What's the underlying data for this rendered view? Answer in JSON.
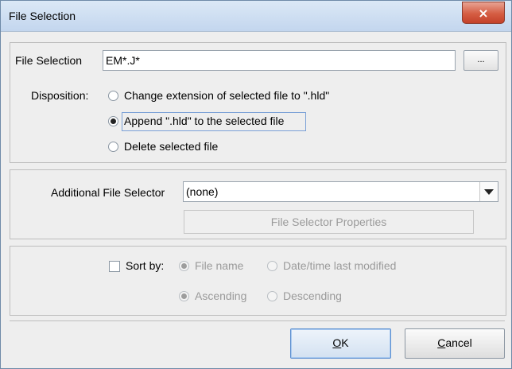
{
  "window": {
    "title": "File Selection",
    "close_glyph": "×"
  },
  "file_selection": {
    "label": "File Selection",
    "value": "EM*.J*",
    "browse_label": "...",
    "disposition_label": "Disposition:",
    "options": [
      {
        "label": "Change extension of selected file to \".hld\"",
        "selected": false
      },
      {
        "label": "Append \".hld\" to the selected file",
        "selected": true
      },
      {
        "label": "Delete selected file",
        "selected": false
      }
    ]
  },
  "additional_selector": {
    "label": "Additional File Selector",
    "value": "(none)",
    "properties_button": "File Selector Properties"
  },
  "sort": {
    "checkbox_label": "Sort by:",
    "checked": false,
    "field_options": [
      {
        "label": "File name",
        "selected": true
      },
      {
        "label": "Date/time last modified",
        "selected": false
      }
    ],
    "order_options": [
      {
        "label": "Ascending",
        "selected": true
      },
      {
        "label": "Descending",
        "selected": false
      }
    ]
  },
  "buttons": {
    "ok_mnemonic": "O",
    "ok_rest": "K",
    "cancel_mnemonic": "C",
    "cancel_rest": "ancel"
  }
}
